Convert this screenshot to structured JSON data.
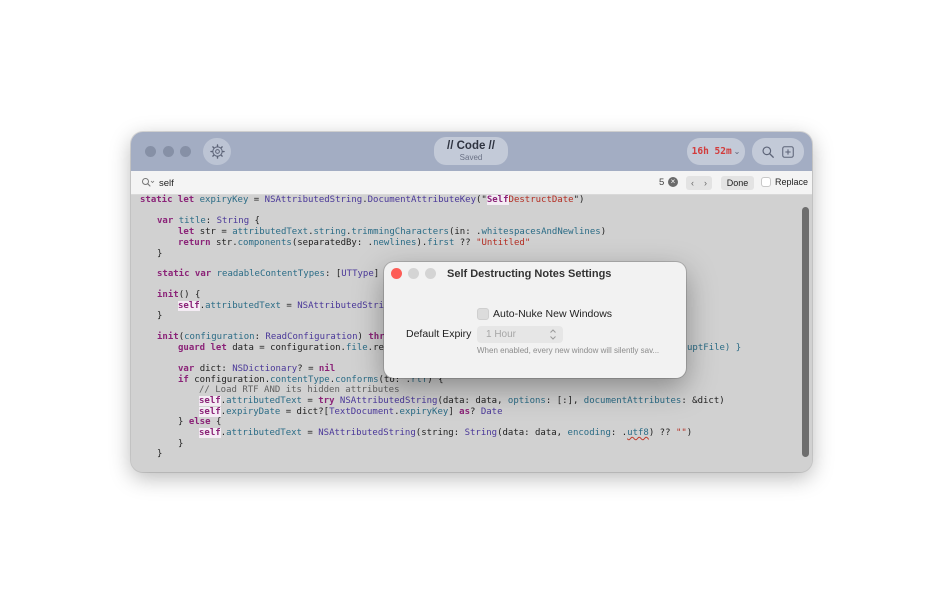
{
  "window": {
    "title": "// Code //",
    "subtitle": "Saved",
    "timer": "16h 52m",
    "timer_chevron": "⌄"
  },
  "icons": {
    "settings": "gear-icon",
    "search": "search-icon",
    "new_window": "plus-square-icon",
    "find": "magnifier-icon"
  },
  "find": {
    "query": "self",
    "count": "5",
    "clear_glyph": "×",
    "prev_glyph": "‹",
    "next_glyph": "›",
    "done_label": "Done",
    "replace_label": "Replace"
  },
  "code_lines": {
    "l0_a": "static let ",
    "l0_b": "expiryKey",
    "l0_c": " = ",
    "l0_d": "NSAttributedString",
    "l0_e": ".",
    "l0_f": "DocumentAttributeKey",
    "l0_g": "(\"",
    "l0_h": "Self",
    "l0_i": "DestructDate",
    "l0_j": "\")",
    "l1_a": "var ",
    "l1_b": "title",
    "l1_c": ": ",
    "l1_d": "String",
    "l1_e": " {",
    "l2_a": "let ",
    "l2_b": "str = ",
    "l2_c": "attributedText",
    "l2_d": ".",
    "l2_e": "string",
    "l2_f": ".",
    "l2_g": "trimmingCharacters",
    "l2_h": "(in: .",
    "l2_i": "whitespacesAndNewlines",
    "l2_j": ")",
    "l3_a": "return ",
    "l3_b": "str.",
    "l3_c": "components",
    "l3_d": "(separatedBy: .",
    "l3_e": "newlines",
    "l3_f": ").",
    "l3_g": "first",
    "l3_h": " ?? ",
    "l3_i": "\"Untitled\"",
    "l4": "}",
    "l5_a": "static var ",
    "l5_b": "readableContentTypes",
    "l5_c": ": [",
    "l5_d": "UTType",
    "l5_e": "]",
    "l6_a": "init",
    "l6_b": "() {",
    "l7_a": "self",
    "l7_b": ".",
    "l7_c": "attributedText",
    "l7_d": " = ",
    "l7_e": "NSAttributedStri",
    "l8": "}",
    "l9_a": "init",
    "l9_b": "(",
    "l9_c": "configuration",
    "l9_d": ": ",
    "l9_e": "ReadConfiguration",
    "l9_f": ") ",
    "l9_g": "thr",
    "l9_tail": "uptFile) }",
    "l10_a": "guard let ",
    "l10_b": "data = configuration.",
    "l10_c": "file",
    "l10_d": ".re",
    "l11_a": "var ",
    "l11_b": "dict: ",
    "l11_c": "NSDictionary",
    "l11_d": "? = ",
    "l11_e": "nil",
    "l12_a": "if ",
    "l12_b": "configuration.",
    "l12_c": "contentType",
    "l12_d": ".",
    "l12_e": "conforms",
    "l12_f": "(to: .",
    "l12_g": "rtf",
    "l12_h": ") {",
    "l13": "// Load RTF AND its hidden attributes",
    "l14_a": "self",
    "l14_b": ".",
    "l14_c": "attributedText",
    "l14_d": " = ",
    "l14_e": "try ",
    "l14_f": "NSAttributedString",
    "l14_g": "(data: data, ",
    "l14_h": "options",
    "l14_i": ": [:], ",
    "l14_j": "documentAttributes",
    "l14_k": ": &dict)",
    "l15_a": "self",
    "l15_b": ".",
    "l15_c": "expiryDate",
    "l15_d": " = dict?[",
    "l15_e": "TextDocument",
    "l15_f": ".",
    "l15_g": "expiryKey",
    "l15_h": "] ",
    "l15_i": "as",
    "l15_j": "? ",
    "l15_k": "Date",
    "l16_a": "} ",
    "l16_b": "else",
    "l16_c": " {",
    "l17_a": "self",
    "l17_b": ".",
    "l17_c": "attributedText",
    "l17_d": " = ",
    "l17_e": "NSAttributedString",
    "l17_f": "(string: ",
    "l17_g": "String",
    "l17_h": "(data: data, ",
    "l17_i": "encoding",
    "l17_j": ": .",
    "l17_k": "utf8",
    "l17_l": ") ?? ",
    "l17_m": "\"\"",
    "l17_n": ")",
    "l18": "}",
    "l19": "}"
  },
  "dialog": {
    "title": "Self Destructing Notes Settings",
    "auto_nuke_label": "Auto-Nuke New Windows",
    "expiry_label": "Default Expiry",
    "expiry_value": "1 Hour",
    "hint": "When enabled, every new window will silently sav..."
  }
}
